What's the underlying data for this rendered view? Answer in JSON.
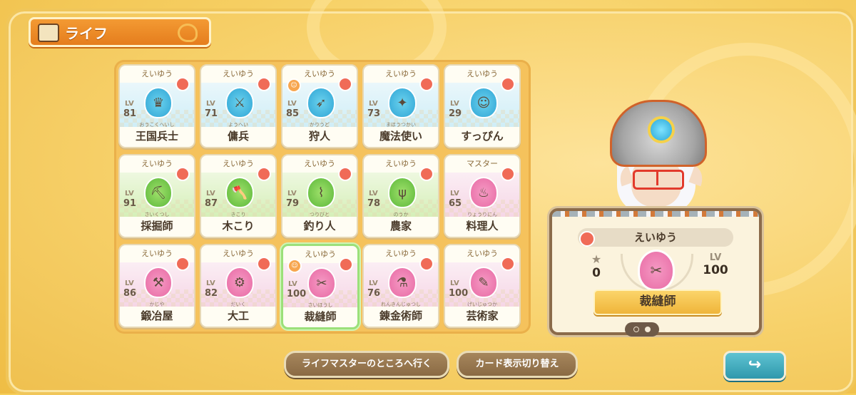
{
  "header": {
    "title": "ライフ",
    "icon": "card-icon"
  },
  "rank_label_common": "えいゆう",
  "cards": [
    {
      "rank": "えいゆう",
      "lv_label": "LV",
      "level": "81",
      "name": "王国兵士",
      "ruby": "おうこくへいし",
      "color": "blue",
      "icon": "shield-crown-icon",
      "glyph": "♛"
    },
    {
      "rank": "えいゆう",
      "lv_label": "LV",
      "level": "71",
      "name": "傭兵",
      "ruby": "ようへい",
      "color": "blue",
      "icon": "sword-icon",
      "glyph": "⚔"
    },
    {
      "rank": "えいゆう",
      "lv_label": "LV",
      "level": "85",
      "name": "狩人",
      "ruby": "かりうど",
      "color": "blue",
      "icon": "bow-icon",
      "glyph": "➶"
    },
    {
      "rank": "えいゆう",
      "lv_label": "LV",
      "level": "73",
      "name": "魔法使い",
      "ruby": "まほうつかい",
      "color": "blue",
      "icon": "wand-icon",
      "glyph": "✦"
    },
    {
      "rank": "えいゆう",
      "lv_label": "LV",
      "level": "29",
      "name": "すっぴん",
      "ruby": "",
      "color": "blue",
      "icon": "person-icon",
      "glyph": "☺"
    },
    {
      "rank": "えいゆう",
      "lv_label": "LV",
      "level": "91",
      "name": "採掘師",
      "ruby": "さいくつし",
      "color": "green",
      "icon": "pickaxe-icon",
      "glyph": "⛏"
    },
    {
      "rank": "えいゆう",
      "lv_label": "LV",
      "level": "87",
      "name": "木こり",
      "ruby": "きこり",
      "color": "green",
      "icon": "axe-icon",
      "glyph": "🪓"
    },
    {
      "rank": "えいゆう",
      "lv_label": "LV",
      "level": "79",
      "name": "釣り人",
      "ruby": "つりびと",
      "color": "green",
      "icon": "fishing-rod-icon",
      "glyph": "⌇"
    },
    {
      "rank": "えいゆう",
      "lv_label": "LV",
      "level": "78",
      "name": "農家",
      "ruby": "のうか",
      "color": "green",
      "icon": "pitchfork-icon",
      "glyph": "ψ"
    },
    {
      "rank": "マスター",
      "lv_label": "LV",
      "level": "65",
      "name": "料理人",
      "ruby": "りょうりにん",
      "color": "pink",
      "icon": "ladle-icon",
      "glyph": "♨"
    },
    {
      "rank": "えいゆう",
      "lv_label": "LV",
      "level": "86",
      "name": "鍛冶屋",
      "ruby": "かじや",
      "color": "pink",
      "icon": "hammer-icon",
      "glyph": "⚒"
    },
    {
      "rank": "えいゆう",
      "lv_label": "LV",
      "level": "82",
      "name": "大工",
      "ruby": "だいく",
      "color": "pink",
      "icon": "saw-icon",
      "glyph": "⚙"
    },
    {
      "rank": "えいゆう",
      "lv_label": "LV",
      "level": "100",
      "name": "裁縫師",
      "ruby": "さいほうし",
      "color": "pink",
      "icon": "needle-icon",
      "glyph": "✂"
    },
    {
      "rank": "えいゆう",
      "lv_label": "LV",
      "level": "76",
      "name": "錬金術師",
      "ruby": "れんきんじゅつし",
      "color": "pink",
      "icon": "flask-icon",
      "glyph": "⚗"
    },
    {
      "rank": "えいゆう",
      "lv_label": "LV",
      "level": "100",
      "name": "芸術家",
      "ruby": "げいじゅつか",
      "color": "pink",
      "icon": "brush-icon",
      "glyph": "✎"
    }
  ],
  "selected_index": 12,
  "info": {
    "rank": "えいゆう",
    "star_count": "0",
    "lv_label": "LV",
    "level": "100",
    "name": "裁縫師"
  },
  "buttons": {
    "go_to_master": "ライフマスターのところへ行く",
    "toggle_card_view": "カード表示切り替え",
    "back": "↪"
  },
  "colors": {
    "background": "#f7cf5a",
    "title_banner": "#e57d1d",
    "selected_border": "#9be07a",
    "button": "#8a6a44",
    "back_button": "#2f98ac"
  }
}
